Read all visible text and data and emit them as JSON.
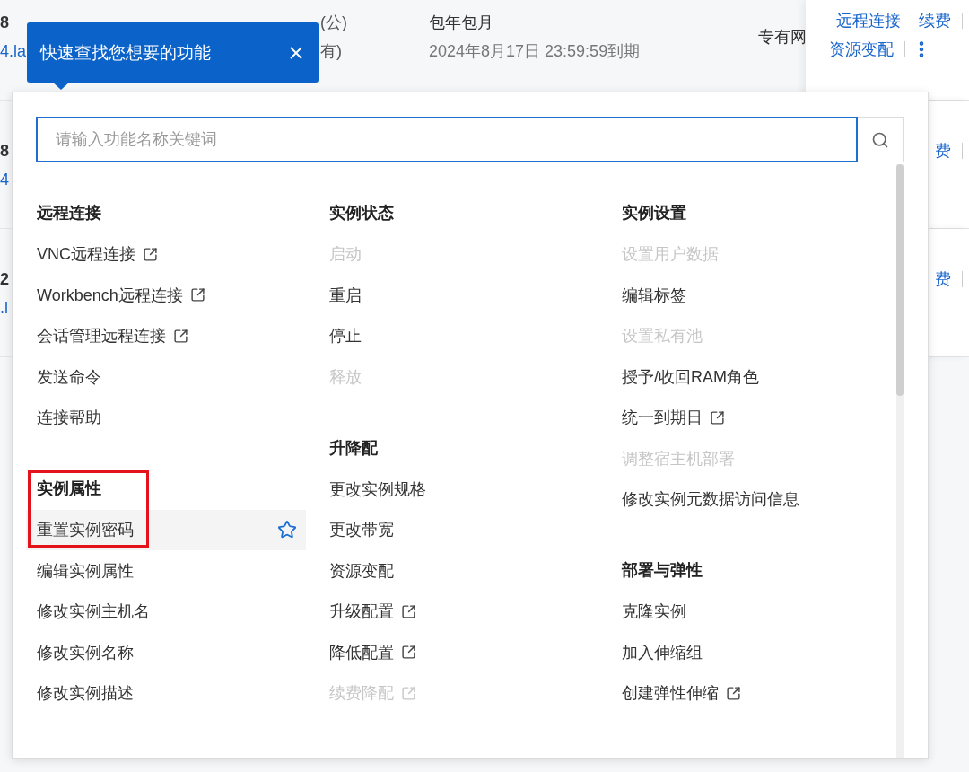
{
  "background_rows": [
    {
      "spec": "8",
      "spec_link": "4.la",
      "ip": "(公)",
      "ip_note": "有)",
      "billing": "包年包月",
      "expiry": "2024年8月17日 23:59:59到期",
      "network": "专有网",
      "action_lines": [
        [
          {
            "kind": "link",
            "label": "远程连接"
          },
          {
            "kind": "link",
            "label": "续费"
          }
        ],
        [
          {
            "kind": "link",
            "label": "资源变配"
          },
          {
            "kind": "more"
          }
        ]
      ]
    },
    {
      "spec": "8",
      "spec_link": "4",
      "action_lines": [
        [
          {
            "kind": "link",
            "label": "费"
          }
        ]
      ]
    },
    {
      "spec": "2",
      "spec_link": ".l",
      "action_lines": [
        [
          {
            "kind": "link",
            "label": "费"
          }
        ]
      ]
    }
  ],
  "tooltip": {
    "text": "快速查找您想要的功能"
  },
  "search": {
    "placeholder": "请输入功能名称关键词"
  },
  "columns": [
    [
      {
        "title": "远程连接",
        "items": [
          {
            "label": "VNC远程连接",
            "external": true,
            "disabled": false
          },
          {
            "label": "Workbench远程连接",
            "external": true,
            "disabled": false
          },
          {
            "label": "会话管理远程连接",
            "external": true,
            "disabled": false
          },
          {
            "label": "发送命令",
            "external": false,
            "disabled": false
          },
          {
            "label": "连接帮助",
            "external": false,
            "disabled": false
          }
        ]
      },
      {
        "title": "实例属性",
        "framed": true,
        "items": [
          {
            "label": "重置实例密码",
            "external": false,
            "disabled": false,
            "hovered": true,
            "starred": false
          },
          {
            "label": "编辑实例属性",
            "external": false,
            "disabled": false
          },
          {
            "label": "修改实例主机名",
            "external": false,
            "disabled": false
          },
          {
            "label": "修改实例名称",
            "external": false,
            "disabled": false
          },
          {
            "label": "修改实例描述",
            "external": false,
            "disabled": false
          }
        ]
      }
    ],
    [
      {
        "title": "实例状态",
        "items": [
          {
            "label": "启动",
            "external": false,
            "disabled": true
          },
          {
            "label": "重启",
            "external": false,
            "disabled": false
          },
          {
            "label": "停止",
            "external": false,
            "disabled": false
          },
          {
            "label": "释放",
            "external": false,
            "disabled": true
          }
        ]
      },
      {
        "title": "升降配",
        "items": [
          {
            "label": "更改实例规格",
            "external": false,
            "disabled": false
          },
          {
            "label": "更改带宽",
            "external": false,
            "disabled": false
          },
          {
            "label": "资源变配",
            "external": false,
            "disabled": false
          },
          {
            "label": "升级配置",
            "external": true,
            "disabled": false
          },
          {
            "label": "降低配置",
            "external": true,
            "disabled": false
          },
          {
            "label": "续费降配",
            "external": true,
            "disabled": true
          }
        ]
      }
    ],
    [
      {
        "title": "实例设置",
        "items": [
          {
            "label": "设置用户数据",
            "external": false,
            "disabled": true
          },
          {
            "label": "编辑标签",
            "external": false,
            "disabled": false
          },
          {
            "label": "设置私有池",
            "external": false,
            "disabled": true
          },
          {
            "label": "授予/收回RAM角色",
            "external": false,
            "disabled": false
          },
          {
            "label": "统一到期日",
            "external": true,
            "disabled": false
          },
          {
            "label": "调整宿主机部署",
            "external": false,
            "disabled": true
          },
          {
            "label": "修改实例元数据访问信息",
            "external": false,
            "disabled": false
          }
        ]
      },
      {
        "title": "部署与弹性",
        "items": [
          {
            "label": "克隆实例",
            "external": false,
            "disabled": false
          },
          {
            "label": "加入伸缩组",
            "external": false,
            "disabled": false
          },
          {
            "label": "创建弹性伸缩",
            "external": true,
            "disabled": false
          }
        ]
      }
    ]
  ]
}
